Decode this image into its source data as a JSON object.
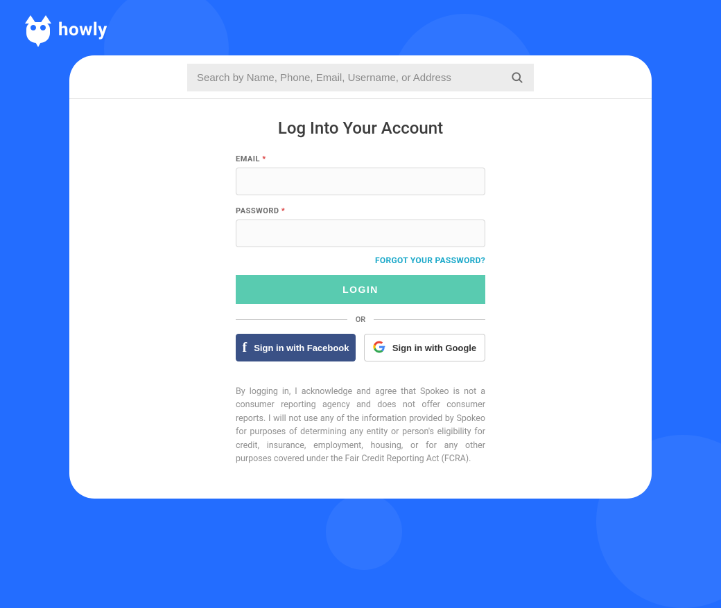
{
  "brand": {
    "name": "howly"
  },
  "search": {
    "placeholder": "Search by Name, Phone, Email, Username, or Address"
  },
  "login": {
    "title": "Log Into Your Account",
    "email_label": "EMAIL",
    "password_label": "PASSWORD",
    "required_mark": "*",
    "forgot": "FORGOT YOUR PASSWORD?",
    "button": "LOGIN",
    "or": "OR",
    "facebook": "Sign in with Facebook",
    "google": "Sign in with Google",
    "disclaimer": "By logging in, I acknowledge and agree that Spokeo is not a consumer reporting agency and does not offer consumer reports. I will not use any of the information provided by Spokeo for purposes of determining any entity or person's eligibility for credit, insurance, employment, housing, or for any other purposes covered under the Fair Credit Reporting Act (FCRA)."
  }
}
